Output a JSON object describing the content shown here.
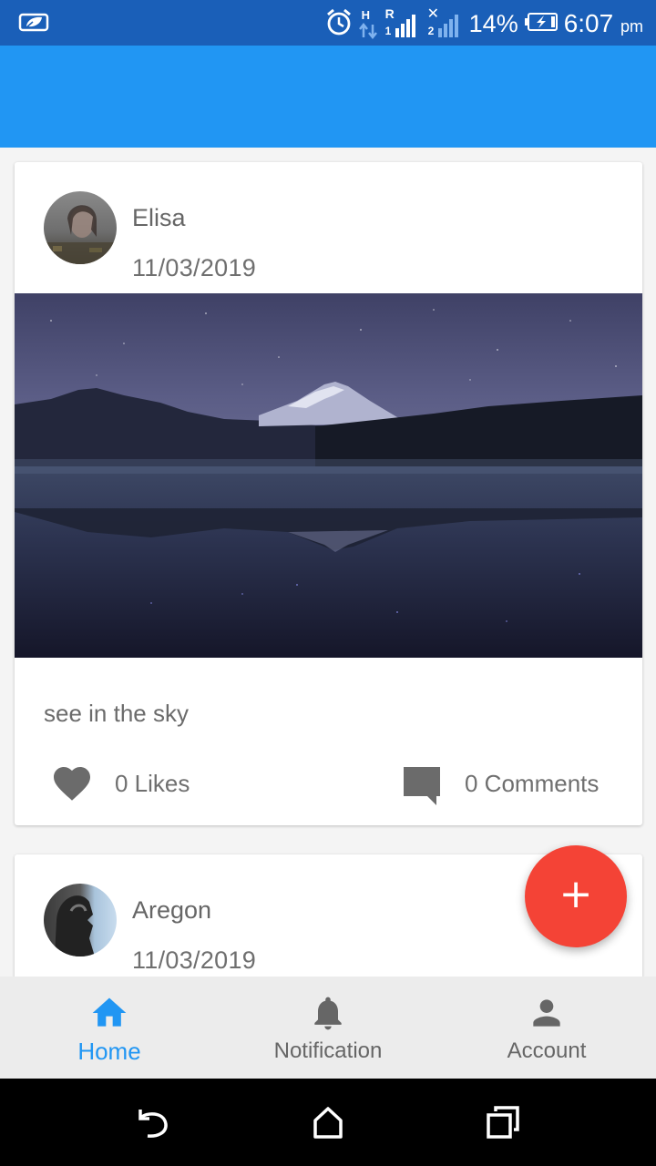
{
  "status_bar": {
    "network_h": "H",
    "network_r": "R",
    "battery_percent": "14%",
    "time": "6:07",
    "time_suffix": "pm"
  },
  "posts": [
    {
      "author": "Elisa",
      "date": "11/03/2019",
      "text": "see in the sky",
      "likes_label": "0 Likes",
      "comments_label": "0 Comments"
    },
    {
      "author": "Aregon",
      "date": "11/03/2019"
    }
  ],
  "fab": {
    "label": "+"
  },
  "bottom_nav": {
    "items": [
      {
        "label": "Home",
        "icon": "home-icon",
        "active": true
      },
      {
        "label": "Notification",
        "icon": "bell-icon",
        "active": false
      },
      {
        "label": "Account",
        "icon": "person-icon",
        "active": false
      }
    ]
  },
  "colors": {
    "status_bar": "#1a5fb8",
    "app_bar": "#2196f3",
    "fab": "#f44336",
    "active_nav": "#2196f3",
    "inactive_nav": "#666666"
  }
}
